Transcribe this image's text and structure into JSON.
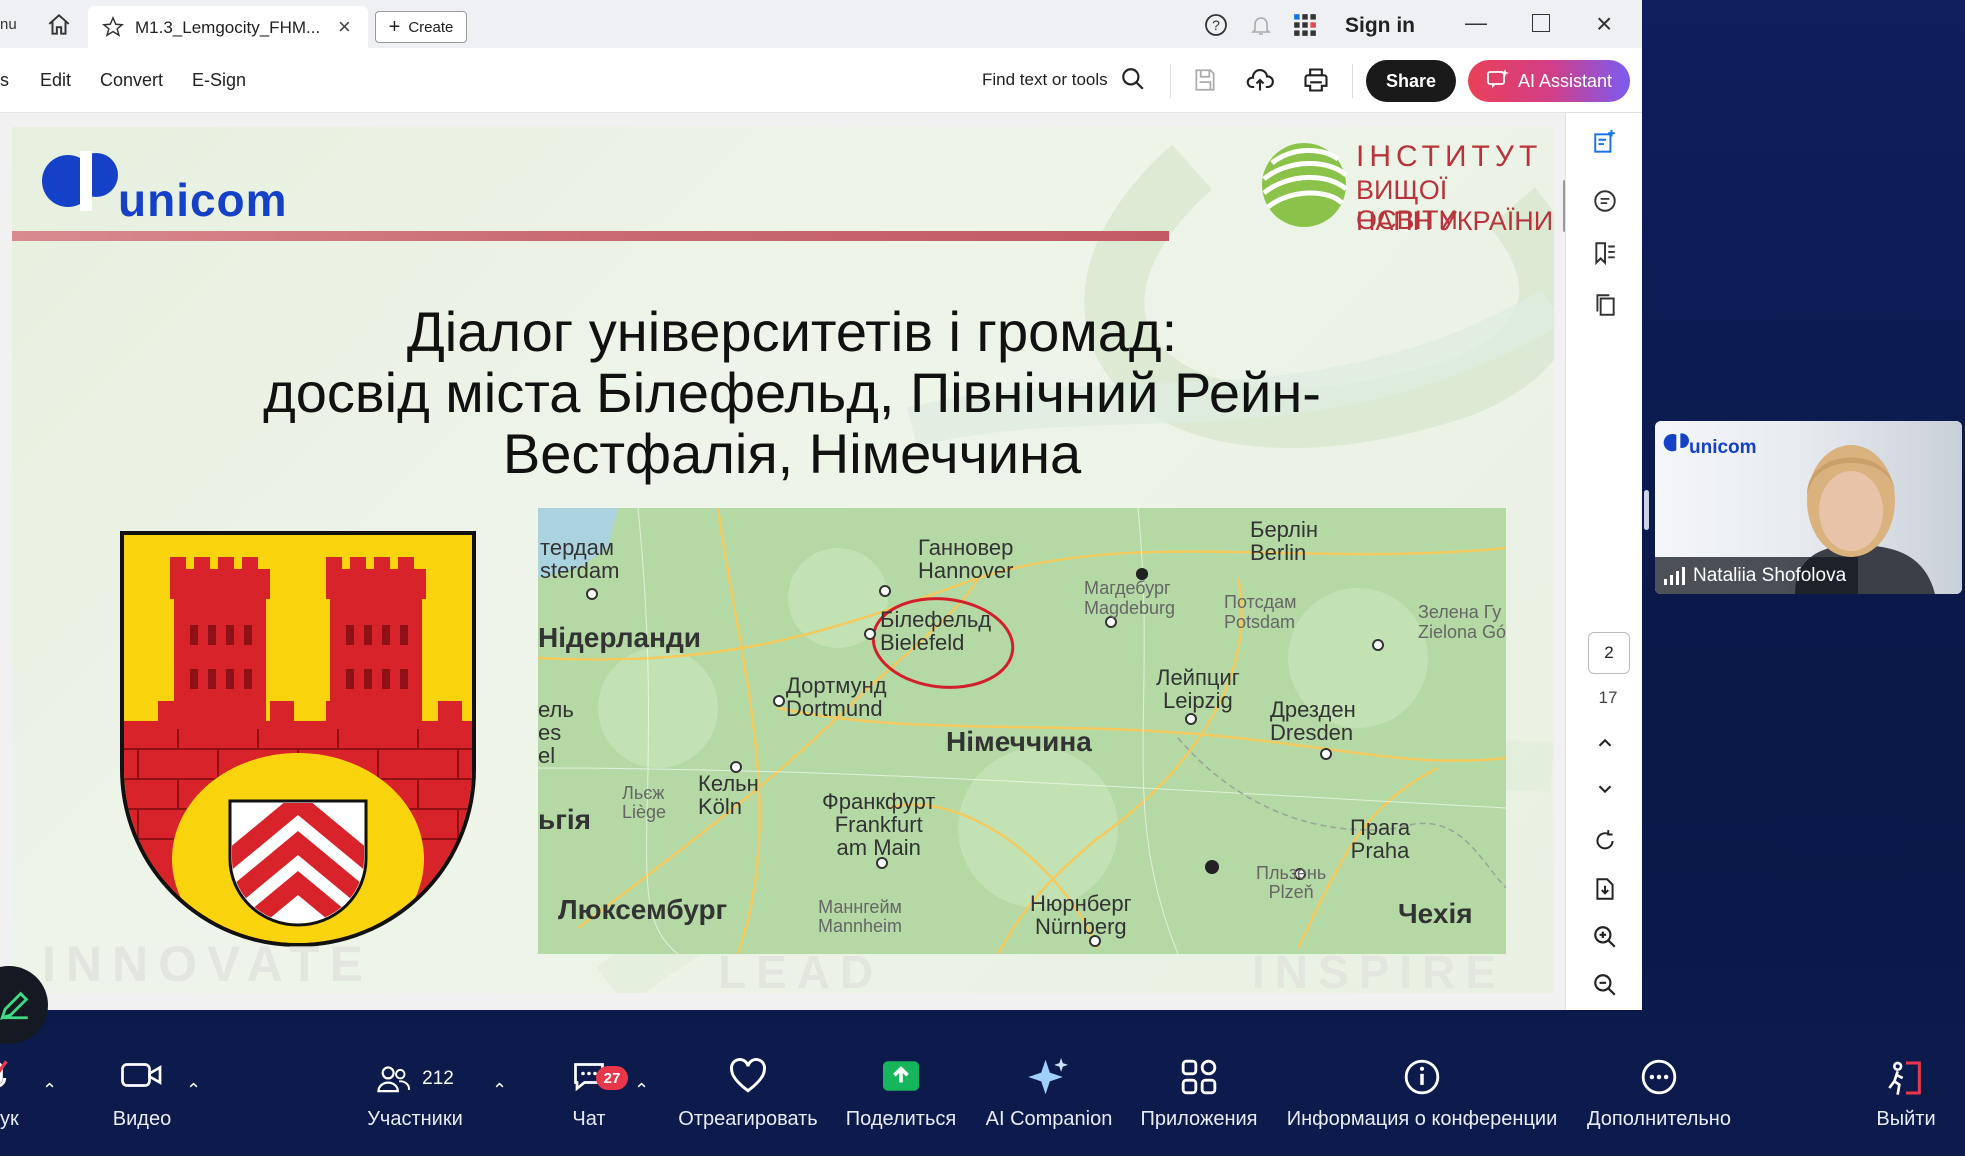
{
  "tabs": {
    "partial_left": "nu",
    "active_title": "M1.3_Lemgocity_FHM...",
    "create_label": "Create"
  },
  "window": {
    "sign_in": "Sign in"
  },
  "menu": {
    "partial_left": "s",
    "edit": "Edit",
    "convert": "Convert",
    "esign": "E-Sign"
  },
  "toolbar": {
    "find_label": "Find text or tools",
    "share_label": "Share",
    "ai_label": "AI Assistant"
  },
  "slide": {
    "logo_left": "unicom",
    "logo_right": [
      "ІНСТИТУТ",
      "ВИЩОЇ ОСВІТИ",
      "НАПН УКРАЇНИ"
    ],
    "title": [
      "Діалог університетів і громад:",
      "досвід міста Білефельд, Північний Рейн-",
      "Вестфалія, Німеччина"
    ],
    "watermarks": [
      "INNOVATE",
      "LEAD",
      "INSPIRE"
    ],
    "map_labels": [
      {
        "id": "amsterdam",
        "text": "тердам\nsterdam"
      },
      {
        "id": "hannover",
        "text": "Ганновер\nHannover"
      },
      {
        "id": "berlin",
        "text": "Берлін\nBerlin"
      },
      {
        "id": "magdeburg",
        "text": "Магдебург\nMagdeburg"
      },
      {
        "id": "potsdam",
        "text": "Потсдам\nPotsdam"
      },
      {
        "id": "zielona",
        "text": "Зелена Гу\nZielona Gó"
      },
      {
        "id": "netherlands",
        "text": "Нідерланди"
      },
      {
        "id": "bielefeld",
        "text": "Білефельд\nBielefeld"
      },
      {
        "id": "leipzig",
        "text": "Лейпциг\nLeipzig"
      },
      {
        "id": "dortmund",
        "text": "Дортмунд\nDortmund"
      },
      {
        "id": "dresden",
        "text": "Дрезден\nDresden"
      },
      {
        "id": "brussels",
        "text": "ель\nes\nel"
      },
      {
        "id": "germany",
        "text": "Німеччина"
      },
      {
        "id": "koln",
        "text": "Кельн\nKöln"
      },
      {
        "id": "liege",
        "text": "Льєж\nLiège"
      },
      {
        "id": "belgium",
        "text": "ьгія"
      },
      {
        "id": "frankfurt",
        "text": "Франкфурт\nFrankfurt\nam Main"
      },
      {
        "id": "praha",
        "text": "Прага\nPraha"
      },
      {
        "id": "plzen",
        "text": "Пльзень\nPlzeň"
      },
      {
        "id": "luxembourg",
        "text": "Люксембург"
      },
      {
        "id": "mannheim",
        "text": "Маннгейм\nMannheim"
      },
      {
        "id": "nurnberg",
        "text": "Нюрнберг\nNürnberg"
      },
      {
        "id": "czechia",
        "text": "Чехія"
      }
    ]
  },
  "pager": {
    "current": "2",
    "total": "17"
  },
  "video": {
    "name": "Nataliia Shofolova",
    "bg_logo": "unicom"
  },
  "zoom_bar": {
    "audio_partial": "ук",
    "video": "Видео",
    "participants": "Участники",
    "participants_count": "212",
    "chat": "Чат",
    "chat_badge": "27",
    "react": "Отреагировать",
    "share": "Поделиться",
    "ai_companion": "AI Companion",
    "apps": "Приложения",
    "info": "Информация о конференции",
    "more": "Дополнительно",
    "leave": "Выйти"
  },
  "colors": {
    "unicom_blue": "#1540c8",
    "institute_red": "#b8343a",
    "coat_yellow": "#f9d40d",
    "coat_red": "#d8232a",
    "share_green": "#17b65d"
  }
}
